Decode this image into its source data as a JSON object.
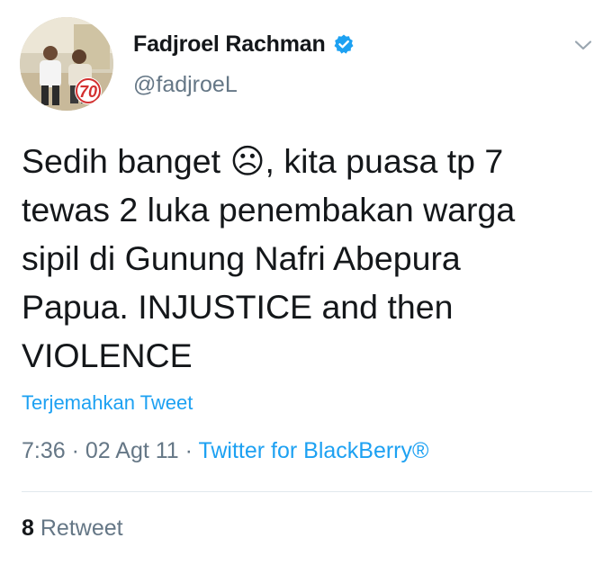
{
  "author": {
    "display_name": "Fadjroel Rachman",
    "handle": "@fadjroeL",
    "verified": true,
    "avatar_badge_text": "70"
  },
  "tweet": {
    "text": "Sedih banget ☹, kita puasa tp 7\ntewas 2 luka penembakan warga\nsipil di Gunung Nafri Abepura\nPapua. INJUSTICE and then\nVIOLENCE",
    "translate_label": "Terjemahkan Tweet",
    "time": "7:36",
    "separator": " · ",
    "date": "02 Agt 11",
    "source": "Twitter for BlackBerry®"
  },
  "stats": {
    "retweet_count": "8",
    "retweet_label": "Retweet"
  },
  "icons": {
    "verified": "verified-badge-icon",
    "menu": "chevron-down-icon"
  },
  "colors": {
    "link": "#1da1f2",
    "secondary_text": "#657786",
    "primary_text": "#14171a",
    "divider": "#e1e8ed"
  }
}
